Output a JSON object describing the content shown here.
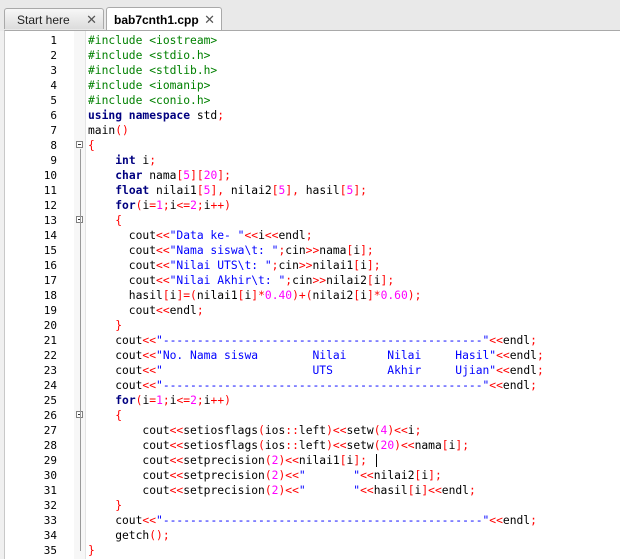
{
  "tabs": [
    {
      "label": "Start here",
      "active": false
    },
    {
      "label": "bab7cnth1.cpp",
      "active": true
    }
  ],
  "close_glyph": "✕",
  "code_lines": [
    [
      [
        "pp",
        "#include <iostream>"
      ]
    ],
    [
      [
        "pp",
        "#include <stdio.h>"
      ]
    ],
    [
      [
        "pp",
        "#include <stdlib.h>"
      ]
    ],
    [
      [
        "pp",
        "#include <iomanip>"
      ]
    ],
    [
      [
        "pp",
        "#include <conio.h>"
      ]
    ],
    [
      [
        "kw",
        "using namespace"
      ],
      [
        "pl",
        " std"
      ],
      [
        "op",
        ";"
      ]
    ],
    [
      [
        "pl",
        "main"
      ],
      [
        "op",
        "()"
      ]
    ],
    [
      [
        "op",
        "{"
      ]
    ],
    [
      [
        "pl",
        "    "
      ],
      [
        "kw",
        "int"
      ],
      [
        "pl",
        " i"
      ],
      [
        "op",
        ";"
      ]
    ],
    [
      [
        "pl",
        "    "
      ],
      [
        "kw",
        "char"
      ],
      [
        "pl",
        " nama"
      ],
      [
        "op",
        "["
      ],
      [
        "nm",
        "5"
      ],
      [
        "op",
        "]["
      ],
      [
        "nm",
        "20"
      ],
      [
        "op",
        "];"
      ]
    ],
    [
      [
        "pl",
        "    "
      ],
      [
        "kw",
        "float"
      ],
      [
        "pl",
        " nilai1"
      ],
      [
        "op",
        "["
      ],
      [
        "nm",
        "5"
      ],
      [
        "op",
        "],"
      ],
      [
        "pl",
        " nilai2"
      ],
      [
        "op",
        "["
      ],
      [
        "nm",
        "5"
      ],
      [
        "op",
        "],"
      ],
      [
        "pl",
        " hasil"
      ],
      [
        "op",
        "["
      ],
      [
        "nm",
        "5"
      ],
      [
        "op",
        "];"
      ]
    ],
    [
      [
        "pl",
        "    "
      ],
      [
        "kw",
        "for"
      ],
      [
        "op",
        "("
      ],
      [
        "pl",
        "i"
      ],
      [
        "op",
        "="
      ],
      [
        "nm",
        "1"
      ],
      [
        "op",
        ";"
      ],
      [
        "pl",
        "i"
      ],
      [
        "op",
        "<="
      ],
      [
        "nm",
        "2"
      ],
      [
        "op",
        ";"
      ],
      [
        "pl",
        "i"
      ],
      [
        "op",
        "++)"
      ]
    ],
    [
      [
        "pl",
        "    "
      ],
      [
        "op",
        "{"
      ]
    ],
    [
      [
        "pl",
        "      cout"
      ],
      [
        "op",
        "<<"
      ],
      [
        "st",
        "\"Data ke- \""
      ],
      [
        "op",
        "<<"
      ],
      [
        "pl",
        "i"
      ],
      [
        "op",
        "<<"
      ],
      [
        "pl",
        "endl"
      ],
      [
        "op",
        ";"
      ]
    ],
    [
      [
        "pl",
        "      cout"
      ],
      [
        "op",
        "<<"
      ],
      [
        "st",
        "\"Nama siswa\\t: \""
      ],
      [
        "op",
        ";"
      ],
      [
        "pl",
        "cin"
      ],
      [
        "op",
        ">>"
      ],
      [
        "pl",
        "nama"
      ],
      [
        "op",
        "["
      ],
      [
        "pl",
        "i"
      ],
      [
        "op",
        "];"
      ]
    ],
    [
      [
        "pl",
        "      cout"
      ],
      [
        "op",
        "<<"
      ],
      [
        "st",
        "\"Nilai UTS\\t: \""
      ],
      [
        "op",
        ";"
      ],
      [
        "pl",
        "cin"
      ],
      [
        "op",
        ">>"
      ],
      [
        "pl",
        "nilai1"
      ],
      [
        "op",
        "["
      ],
      [
        "pl",
        "i"
      ],
      [
        "op",
        "];"
      ]
    ],
    [
      [
        "pl",
        "      cout"
      ],
      [
        "op",
        "<<"
      ],
      [
        "st",
        "\"Nilai Akhir\\t: \""
      ],
      [
        "op",
        ";"
      ],
      [
        "pl",
        "cin"
      ],
      [
        "op",
        ">>"
      ],
      [
        "pl",
        "nilai2"
      ],
      [
        "op",
        "["
      ],
      [
        "pl",
        "i"
      ],
      [
        "op",
        "];"
      ]
    ],
    [
      [
        "pl",
        "      hasil"
      ],
      [
        "op",
        "["
      ],
      [
        "pl",
        "i"
      ],
      [
        "op",
        "]=("
      ],
      [
        "pl",
        "nilai1"
      ],
      [
        "op",
        "["
      ],
      [
        "pl",
        "i"
      ],
      [
        "op",
        "]*"
      ],
      [
        "nm",
        "0.40"
      ],
      [
        "op",
        ")+("
      ],
      [
        "pl",
        "nilai2"
      ],
      [
        "op",
        "["
      ],
      [
        "pl",
        "i"
      ],
      [
        "op",
        "]*"
      ],
      [
        "nm",
        "0.60"
      ],
      [
        "op",
        ");"
      ]
    ],
    [
      [
        "pl",
        "      cout"
      ],
      [
        "op",
        "<<"
      ],
      [
        "pl",
        "endl"
      ],
      [
        "op",
        ";"
      ]
    ],
    [
      [
        "pl",
        "    "
      ],
      [
        "op",
        "}"
      ]
    ],
    [
      [
        "pl",
        "    cout"
      ],
      [
        "op",
        "<<"
      ],
      [
        "st",
        "\"-----------------------------------------------\""
      ],
      [
        "op",
        "<<"
      ],
      [
        "pl",
        "endl"
      ],
      [
        "op",
        ";"
      ]
    ],
    [
      [
        "pl",
        "    cout"
      ],
      [
        "op",
        "<<"
      ],
      [
        "st",
        "\"No. Nama siswa        Nilai      Nilai     Hasil\""
      ],
      [
        "op",
        "<<"
      ],
      [
        "pl",
        "endl"
      ],
      [
        "op",
        ";"
      ]
    ],
    [
      [
        "pl",
        "    cout"
      ],
      [
        "op",
        "<<"
      ],
      [
        "st",
        "\"                      UTS        Akhir     Ujian\""
      ],
      [
        "op",
        "<<"
      ],
      [
        "pl",
        "endl"
      ],
      [
        "op",
        ";"
      ]
    ],
    [
      [
        "pl",
        "    cout"
      ],
      [
        "op",
        "<<"
      ],
      [
        "st",
        "\"-----------------------------------------------\""
      ],
      [
        "op",
        "<<"
      ],
      [
        "pl",
        "endl"
      ],
      [
        "op",
        ";"
      ]
    ],
    [
      [
        "pl",
        "    "
      ],
      [
        "kw",
        "for"
      ],
      [
        "op",
        "("
      ],
      [
        "pl",
        "i"
      ],
      [
        "op",
        "="
      ],
      [
        "nm",
        "1"
      ],
      [
        "op",
        ";"
      ],
      [
        "pl",
        "i"
      ],
      [
        "op",
        "<="
      ],
      [
        "nm",
        "2"
      ],
      [
        "op",
        ";"
      ],
      [
        "pl",
        "i"
      ],
      [
        "op",
        "++)"
      ]
    ],
    [
      [
        "pl",
        "    "
      ],
      [
        "op",
        "{"
      ]
    ],
    [
      [
        "pl",
        "        cout"
      ],
      [
        "op",
        "<<"
      ],
      [
        "pl",
        "setiosflags"
      ],
      [
        "op",
        "("
      ],
      [
        "pl",
        "ios"
      ],
      [
        "op",
        "::"
      ],
      [
        "pl",
        "left"
      ],
      [
        "op",
        ")<<"
      ],
      [
        "pl",
        "setw"
      ],
      [
        "op",
        "("
      ],
      [
        "nm",
        "4"
      ],
      [
        "op",
        ")<<"
      ],
      [
        "pl",
        "i"
      ],
      [
        "op",
        ";"
      ]
    ],
    [
      [
        "pl",
        "        cout"
      ],
      [
        "op",
        "<<"
      ],
      [
        "pl",
        "setiosflags"
      ],
      [
        "op",
        "("
      ],
      [
        "pl",
        "ios"
      ],
      [
        "op",
        "::"
      ],
      [
        "pl",
        "left"
      ],
      [
        "op",
        ")<<"
      ],
      [
        "pl",
        "setw"
      ],
      [
        "op",
        "("
      ],
      [
        "nm",
        "20"
      ],
      [
        "op",
        ")<<"
      ],
      [
        "pl",
        "nama"
      ],
      [
        "op",
        "["
      ],
      [
        "pl",
        "i"
      ],
      [
        "op",
        "];"
      ]
    ],
    [
      [
        "pl",
        "        cout"
      ],
      [
        "op",
        "<<"
      ],
      [
        "pl",
        "setprecision"
      ],
      [
        "op",
        "("
      ],
      [
        "nm",
        "2"
      ],
      [
        "op",
        ")<<"
      ],
      [
        "pl",
        "nilai1"
      ],
      [
        "op",
        "["
      ],
      [
        "pl",
        "i"
      ],
      [
        "op",
        "];"
      ]
    ],
    [
      [
        "pl",
        "        cout"
      ],
      [
        "op",
        "<<"
      ],
      [
        "pl",
        "setprecision"
      ],
      [
        "op",
        "("
      ],
      [
        "nm",
        "2"
      ],
      [
        "op",
        ")<<"
      ],
      [
        "st",
        "\"       \""
      ],
      [
        "op",
        "<<"
      ],
      [
        "pl",
        "nilai2"
      ],
      [
        "op",
        "["
      ],
      [
        "pl",
        "i"
      ],
      [
        "op",
        "];"
      ]
    ],
    [
      [
        "pl",
        "        cout"
      ],
      [
        "op",
        "<<"
      ],
      [
        "pl",
        "setprecision"
      ],
      [
        "op",
        "("
      ],
      [
        "nm",
        "2"
      ],
      [
        "op",
        ")<<"
      ],
      [
        "st",
        "\"       \""
      ],
      [
        "op",
        "<<"
      ],
      [
        "pl",
        "hasil"
      ],
      [
        "op",
        "["
      ],
      [
        "pl",
        "i"
      ],
      [
        "op",
        "]<<"
      ],
      [
        "pl",
        "endl"
      ],
      [
        "op",
        ";"
      ]
    ],
    [
      [
        "pl",
        "    "
      ],
      [
        "op",
        "}"
      ]
    ],
    [
      [
        "pl",
        "    cout"
      ],
      [
        "op",
        "<<"
      ],
      [
        "st",
        "\"-----------------------------------------------\""
      ],
      [
        "op",
        "<<"
      ],
      [
        "pl",
        "endl"
      ],
      [
        "op",
        ";"
      ]
    ],
    [
      [
        "pl",
        "    getch"
      ],
      [
        "op",
        "();"
      ]
    ],
    [
      [
        "op",
        "}"
      ]
    ]
  ]
}
